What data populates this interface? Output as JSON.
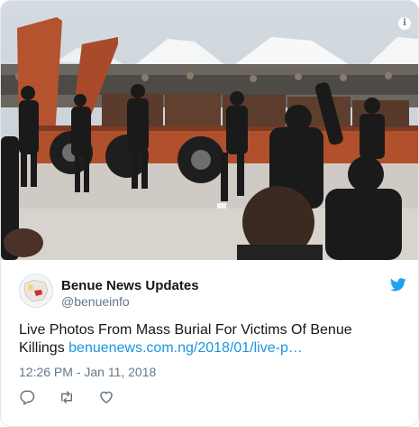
{
  "embed": {
    "info_icon": "info-icon",
    "author": {
      "name": "Benue News Updates",
      "handle": "@benueinfo",
      "avatar_icon": "benue-map-avatar"
    },
    "tweet": {
      "text": "Live Photos From Mass Burial For Victims Of Benue Killings ",
      "link": "benuenews.com.ng/2018/01/live-p…"
    },
    "timestamp": "12:26 PM - Jan 11, 2018",
    "actions": [
      "reply-icon",
      "retweet-icon",
      "like-icon"
    ],
    "colors": {
      "twitter_blue": "#1da1f2",
      "link": "#1b95e0",
      "secondary_text": "#657786",
      "primary_text": "#14171a"
    }
  }
}
